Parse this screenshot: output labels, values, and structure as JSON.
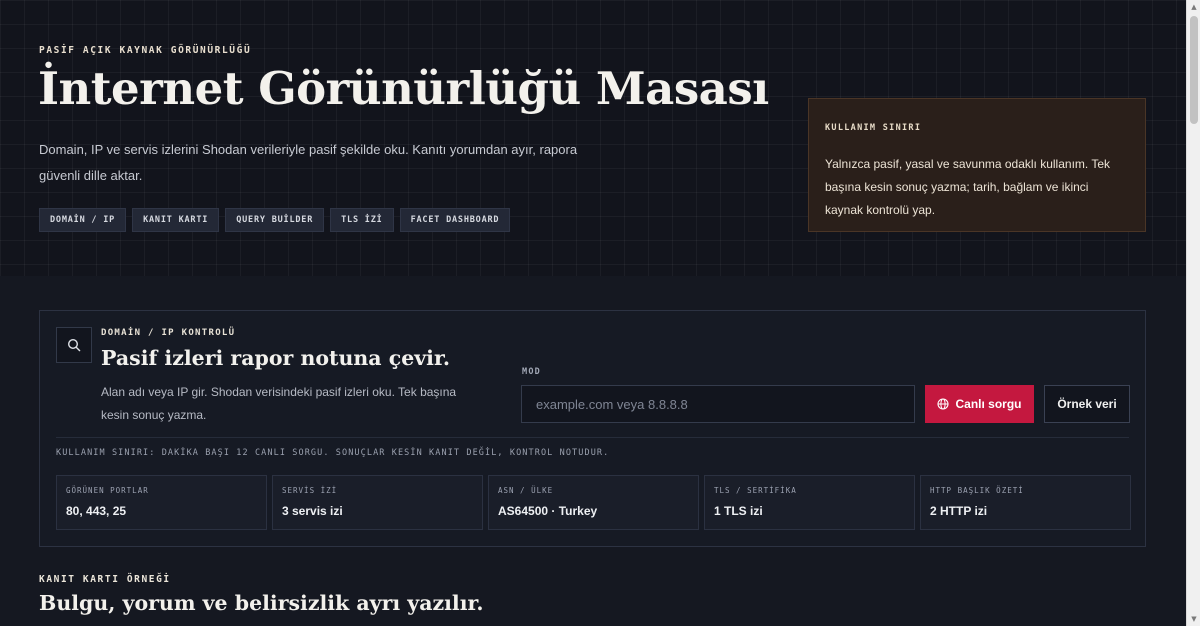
{
  "hero": {
    "eyebrow": "PASİF AÇIK KAYNAK GÖRÜNÜRLÜĞÜ",
    "title": "İnternet Görünürlüğü Masası",
    "description": "Domain, IP ve servis izlerini Shodan verileriyle pasif şekilde oku. Kanıtı yorumdan ayır, rapora güvenli dille aktar.",
    "chips": [
      "DOMAİN / IP",
      "KANIT KARTI",
      "QUERY BUİLDER",
      "TLS İZİ",
      "FACET DASHBOARD"
    ]
  },
  "warning": {
    "title": "KULLANIM SINIRI",
    "text": "Yalnızca pasif, yasal ve savunma odaklı kullanım. Tek başına kesin sonuç yazma; tarih, bağlam ve ikinci kaynak kontrolü yap."
  },
  "panel": {
    "icon": "search-icon",
    "eyebrow": "DOMAİN / IP KONTROLÜ",
    "title": "Pasif izleri rapor notuna çevir.",
    "description": "Alan adı veya IP gir. Shodan verisindeki pasif izleri oku. Tek başına kesin sonuç yazma.",
    "mode_label": "MOD",
    "input_value": "",
    "input_placeholder": "example.com veya 8.8.8.8",
    "live_button": "Canlı sorgu",
    "live_button_icon": "globe-icon",
    "sample_button": "Örnek veri",
    "limit_note": "KULLANIM SINIRI: DAKİKA BAŞI 12 CANLI SORGU. SONUÇLAR KESİN KANIT DEĞİL, KONTROL NOTUDUR.",
    "stats": [
      {
        "label": "GÖRÜNEN PORTLAR",
        "value": "80, 443, 25"
      },
      {
        "label": "SERVİS İZİ",
        "value": "3 servis izi"
      },
      {
        "label": "ASN / ÜLKE",
        "value": "AS64500 · Turkey"
      },
      {
        "label": "TLS / SERTİFİKA",
        "value": "1 TLS izi"
      },
      {
        "label": "HTTP BAŞLIK ÖZETİ",
        "value": "2 HTTP izi"
      }
    ]
  },
  "section": {
    "eyebrow": "KANIT KARTI ÖRNEĞİ",
    "title": "Bulgu, yorum ve belirsizlik ayrı yazılır."
  },
  "colors": {
    "background": "#12141c",
    "accent": "#c4183f",
    "warning_bg": "#2a1f1a"
  }
}
